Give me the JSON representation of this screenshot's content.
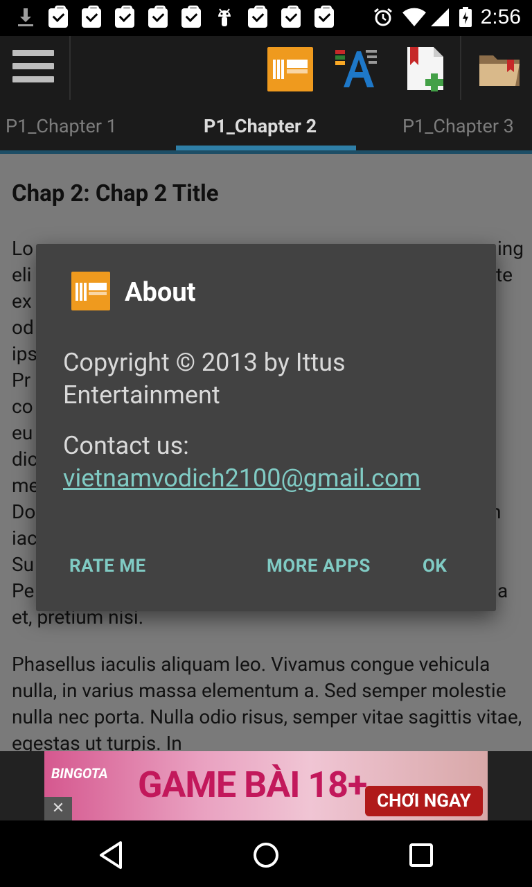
{
  "status_bar": {
    "time": "2:56",
    "icons": [
      "download-icon",
      "clipboard-check-icon",
      "clipboard-check-icon",
      "clipboard-check-icon",
      "clipboard-check-icon",
      "clipboard-check-icon",
      "android-icon",
      "clipboard-check-icon",
      "clipboard-check-icon",
      "clipboard-check-icon",
      "alarm-icon",
      "wifi-icon",
      "signal-icon",
      "battery-charging-icon"
    ]
  },
  "toolbar": {
    "icons": [
      "menu-icon",
      "book-reader-logo-icon",
      "font-size-icon",
      "add-bookmark-icon",
      "bookmarks-folder-icon"
    ]
  },
  "tabs": [
    {
      "label": "P1_Chapter 1",
      "active": false
    },
    {
      "label": "P1_Chapter 2",
      "active": true
    },
    {
      "label": "P1_Chapter 3",
      "active": false
    }
  ],
  "content": {
    "chapter_title": "Chap 2: Chap 2 Title",
    "para1_lines": [
      "Lo",
      "eli",
      "ex",
      "od",
      "ips",
      "Pr",
      "co",
      "eu",
      "dic",
      "me",
      "Do",
      "iac",
      "Su",
      "Pe",
      "et, pretium nisi."
    ],
    "para1_right_fragments": [
      "ing",
      "te",
      "n",
      "a"
    ],
    "para2": "Phasellus iaculis aliquam leo. Vivamus congue vehicula nulla, in varius massa elementum a. Sed semper molestie nulla nec porta. Nulla odio risus, semper vitae sagittis vitae, egestas ut turpis. In"
  },
  "dialog": {
    "icon_label": "BOOK READER",
    "title": "About",
    "copyright": "Copyright © 2013 by Ittus Entertainment",
    "contact_label": "Contact us:",
    "email": "vietnamvodich2100@gmail.com",
    "buttons": {
      "rate": "RATE ME",
      "more": "MORE APPS",
      "ok": "OK"
    }
  },
  "ad": {
    "brand": "BINGOTA",
    "headline": "GAME BÀI 18+",
    "cta": "CHƠI NGAY",
    "close": "✕"
  },
  "colors": {
    "accent": "#80cbc4",
    "tab_indicator": "#2f7fa7",
    "dialog_bg": "#424242",
    "dim_content_bg": "#7a7a7a"
  }
}
